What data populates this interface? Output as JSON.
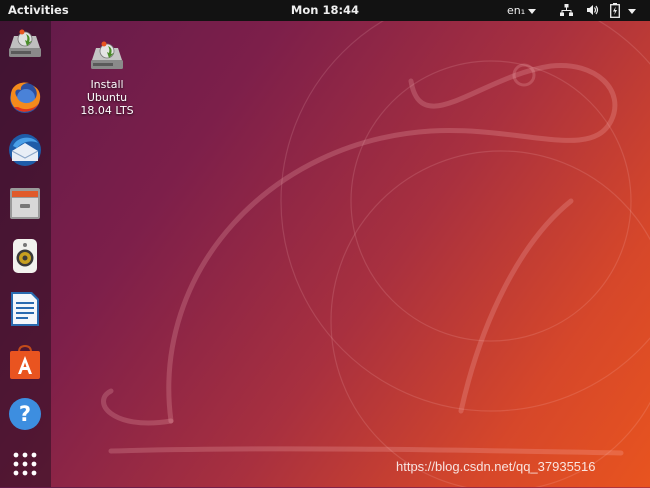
{
  "topbar": {
    "activities": "Activities",
    "clock": "Mon 18:44",
    "language": "en₁"
  },
  "dock": {
    "items": [
      {
        "name": "install-ubuntu"
      },
      {
        "name": "firefox"
      },
      {
        "name": "thunderbird"
      },
      {
        "name": "files"
      },
      {
        "name": "rhythmbox"
      },
      {
        "name": "libreoffice-writer"
      },
      {
        "name": "ubuntu-software"
      },
      {
        "name": "help"
      },
      {
        "name": "show-applications"
      }
    ]
  },
  "desktop": {
    "install_icon": {
      "line1": "Install",
      "line2": "Ubuntu",
      "line3": "18.04 LTS"
    }
  },
  "watermark": "https://blog.csdn.net/qq_37935516",
  "colors": {
    "topbar": "#121212",
    "wallpaper_start": "#5e1a4a",
    "wallpaper_end": "#e8541f",
    "ubuntu_orange": "#e95420"
  }
}
